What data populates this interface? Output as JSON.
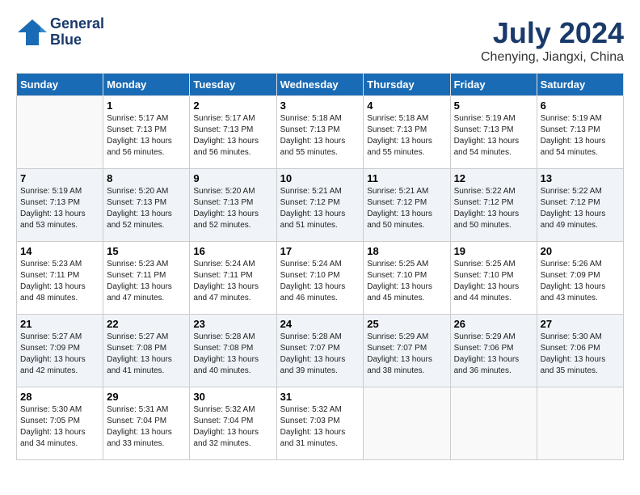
{
  "header": {
    "logo_line1": "General",
    "logo_line2": "Blue",
    "month": "July 2024",
    "location": "Chenying, Jiangxi, China"
  },
  "weekdays": [
    "Sunday",
    "Monday",
    "Tuesday",
    "Wednesday",
    "Thursday",
    "Friday",
    "Saturday"
  ],
  "weeks": [
    [
      {
        "day": "",
        "info": ""
      },
      {
        "day": "1",
        "info": "Sunrise: 5:17 AM\nSunset: 7:13 PM\nDaylight: 13 hours\nand 56 minutes."
      },
      {
        "day": "2",
        "info": "Sunrise: 5:17 AM\nSunset: 7:13 PM\nDaylight: 13 hours\nand 56 minutes."
      },
      {
        "day": "3",
        "info": "Sunrise: 5:18 AM\nSunset: 7:13 PM\nDaylight: 13 hours\nand 55 minutes."
      },
      {
        "day": "4",
        "info": "Sunrise: 5:18 AM\nSunset: 7:13 PM\nDaylight: 13 hours\nand 55 minutes."
      },
      {
        "day": "5",
        "info": "Sunrise: 5:19 AM\nSunset: 7:13 PM\nDaylight: 13 hours\nand 54 minutes."
      },
      {
        "day": "6",
        "info": "Sunrise: 5:19 AM\nSunset: 7:13 PM\nDaylight: 13 hours\nand 54 minutes."
      }
    ],
    [
      {
        "day": "7",
        "info": "Sunrise: 5:19 AM\nSunset: 7:13 PM\nDaylight: 13 hours\nand 53 minutes."
      },
      {
        "day": "8",
        "info": "Sunrise: 5:20 AM\nSunset: 7:13 PM\nDaylight: 13 hours\nand 52 minutes."
      },
      {
        "day": "9",
        "info": "Sunrise: 5:20 AM\nSunset: 7:13 PM\nDaylight: 13 hours\nand 52 minutes."
      },
      {
        "day": "10",
        "info": "Sunrise: 5:21 AM\nSunset: 7:12 PM\nDaylight: 13 hours\nand 51 minutes."
      },
      {
        "day": "11",
        "info": "Sunrise: 5:21 AM\nSunset: 7:12 PM\nDaylight: 13 hours\nand 50 minutes."
      },
      {
        "day": "12",
        "info": "Sunrise: 5:22 AM\nSunset: 7:12 PM\nDaylight: 13 hours\nand 50 minutes."
      },
      {
        "day": "13",
        "info": "Sunrise: 5:22 AM\nSunset: 7:12 PM\nDaylight: 13 hours\nand 49 minutes."
      }
    ],
    [
      {
        "day": "14",
        "info": "Sunrise: 5:23 AM\nSunset: 7:11 PM\nDaylight: 13 hours\nand 48 minutes."
      },
      {
        "day": "15",
        "info": "Sunrise: 5:23 AM\nSunset: 7:11 PM\nDaylight: 13 hours\nand 47 minutes."
      },
      {
        "day": "16",
        "info": "Sunrise: 5:24 AM\nSunset: 7:11 PM\nDaylight: 13 hours\nand 47 minutes."
      },
      {
        "day": "17",
        "info": "Sunrise: 5:24 AM\nSunset: 7:10 PM\nDaylight: 13 hours\nand 46 minutes."
      },
      {
        "day": "18",
        "info": "Sunrise: 5:25 AM\nSunset: 7:10 PM\nDaylight: 13 hours\nand 45 minutes."
      },
      {
        "day": "19",
        "info": "Sunrise: 5:25 AM\nSunset: 7:10 PM\nDaylight: 13 hours\nand 44 minutes."
      },
      {
        "day": "20",
        "info": "Sunrise: 5:26 AM\nSunset: 7:09 PM\nDaylight: 13 hours\nand 43 minutes."
      }
    ],
    [
      {
        "day": "21",
        "info": "Sunrise: 5:27 AM\nSunset: 7:09 PM\nDaylight: 13 hours\nand 42 minutes."
      },
      {
        "day": "22",
        "info": "Sunrise: 5:27 AM\nSunset: 7:08 PM\nDaylight: 13 hours\nand 41 minutes."
      },
      {
        "day": "23",
        "info": "Sunrise: 5:28 AM\nSunset: 7:08 PM\nDaylight: 13 hours\nand 40 minutes."
      },
      {
        "day": "24",
        "info": "Sunrise: 5:28 AM\nSunset: 7:07 PM\nDaylight: 13 hours\nand 39 minutes."
      },
      {
        "day": "25",
        "info": "Sunrise: 5:29 AM\nSunset: 7:07 PM\nDaylight: 13 hours\nand 38 minutes."
      },
      {
        "day": "26",
        "info": "Sunrise: 5:29 AM\nSunset: 7:06 PM\nDaylight: 13 hours\nand 36 minutes."
      },
      {
        "day": "27",
        "info": "Sunrise: 5:30 AM\nSunset: 7:06 PM\nDaylight: 13 hours\nand 35 minutes."
      }
    ],
    [
      {
        "day": "28",
        "info": "Sunrise: 5:30 AM\nSunset: 7:05 PM\nDaylight: 13 hours\nand 34 minutes."
      },
      {
        "day": "29",
        "info": "Sunrise: 5:31 AM\nSunset: 7:04 PM\nDaylight: 13 hours\nand 33 minutes."
      },
      {
        "day": "30",
        "info": "Sunrise: 5:32 AM\nSunset: 7:04 PM\nDaylight: 13 hours\nand 32 minutes."
      },
      {
        "day": "31",
        "info": "Sunrise: 5:32 AM\nSunset: 7:03 PM\nDaylight: 13 hours\nand 31 minutes."
      },
      {
        "day": "",
        "info": ""
      },
      {
        "day": "",
        "info": ""
      },
      {
        "day": "",
        "info": ""
      }
    ]
  ]
}
